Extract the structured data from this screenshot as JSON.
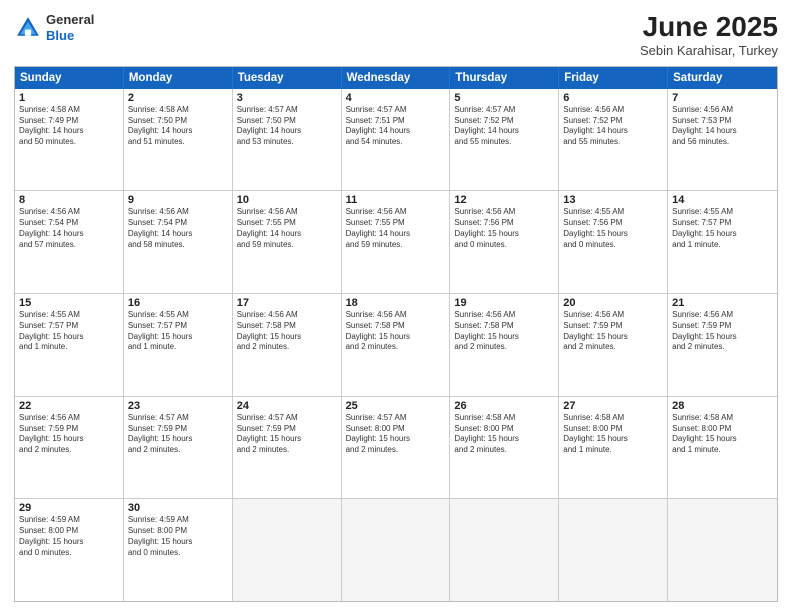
{
  "logo": {
    "general": "General",
    "blue": "Blue"
  },
  "title": "June 2025",
  "subtitle": "Sebin Karahisar, Turkey",
  "days": [
    "Sunday",
    "Monday",
    "Tuesday",
    "Wednesday",
    "Thursday",
    "Friday",
    "Saturday"
  ],
  "rows": [
    [
      {
        "day": "1",
        "lines": [
          "Sunrise: 4:58 AM",
          "Sunset: 7:49 PM",
          "Daylight: 14 hours",
          "and 50 minutes."
        ]
      },
      {
        "day": "2",
        "lines": [
          "Sunrise: 4:58 AM",
          "Sunset: 7:50 PM",
          "Daylight: 14 hours",
          "and 51 minutes."
        ]
      },
      {
        "day": "3",
        "lines": [
          "Sunrise: 4:57 AM",
          "Sunset: 7:50 PM",
          "Daylight: 14 hours",
          "and 53 minutes."
        ]
      },
      {
        "day": "4",
        "lines": [
          "Sunrise: 4:57 AM",
          "Sunset: 7:51 PM",
          "Daylight: 14 hours",
          "and 54 minutes."
        ]
      },
      {
        "day": "5",
        "lines": [
          "Sunrise: 4:57 AM",
          "Sunset: 7:52 PM",
          "Daylight: 14 hours",
          "and 55 minutes."
        ]
      },
      {
        "day": "6",
        "lines": [
          "Sunrise: 4:56 AM",
          "Sunset: 7:52 PM",
          "Daylight: 14 hours",
          "and 55 minutes."
        ]
      },
      {
        "day": "7",
        "lines": [
          "Sunrise: 4:56 AM",
          "Sunset: 7:53 PM",
          "Daylight: 14 hours",
          "and 56 minutes."
        ]
      }
    ],
    [
      {
        "day": "8",
        "lines": [
          "Sunrise: 4:56 AM",
          "Sunset: 7:54 PM",
          "Daylight: 14 hours",
          "and 57 minutes."
        ]
      },
      {
        "day": "9",
        "lines": [
          "Sunrise: 4:56 AM",
          "Sunset: 7:54 PM",
          "Daylight: 14 hours",
          "and 58 minutes."
        ]
      },
      {
        "day": "10",
        "lines": [
          "Sunrise: 4:56 AM",
          "Sunset: 7:55 PM",
          "Daylight: 14 hours",
          "and 59 minutes."
        ]
      },
      {
        "day": "11",
        "lines": [
          "Sunrise: 4:56 AM",
          "Sunset: 7:55 PM",
          "Daylight: 14 hours",
          "and 59 minutes."
        ]
      },
      {
        "day": "12",
        "lines": [
          "Sunrise: 4:56 AM",
          "Sunset: 7:56 PM",
          "Daylight: 15 hours",
          "and 0 minutes."
        ]
      },
      {
        "day": "13",
        "lines": [
          "Sunrise: 4:55 AM",
          "Sunset: 7:56 PM",
          "Daylight: 15 hours",
          "and 0 minutes."
        ]
      },
      {
        "day": "14",
        "lines": [
          "Sunrise: 4:55 AM",
          "Sunset: 7:57 PM",
          "Daylight: 15 hours",
          "and 1 minute."
        ]
      }
    ],
    [
      {
        "day": "15",
        "lines": [
          "Sunrise: 4:55 AM",
          "Sunset: 7:57 PM",
          "Daylight: 15 hours",
          "and 1 minute."
        ]
      },
      {
        "day": "16",
        "lines": [
          "Sunrise: 4:55 AM",
          "Sunset: 7:57 PM",
          "Daylight: 15 hours",
          "and 1 minute."
        ]
      },
      {
        "day": "17",
        "lines": [
          "Sunrise: 4:56 AM",
          "Sunset: 7:58 PM",
          "Daylight: 15 hours",
          "and 2 minutes."
        ]
      },
      {
        "day": "18",
        "lines": [
          "Sunrise: 4:56 AM",
          "Sunset: 7:58 PM",
          "Daylight: 15 hours",
          "and 2 minutes."
        ]
      },
      {
        "day": "19",
        "lines": [
          "Sunrise: 4:56 AM",
          "Sunset: 7:58 PM",
          "Daylight: 15 hours",
          "and 2 minutes."
        ]
      },
      {
        "day": "20",
        "lines": [
          "Sunrise: 4:56 AM",
          "Sunset: 7:59 PM",
          "Daylight: 15 hours",
          "and 2 minutes."
        ]
      },
      {
        "day": "21",
        "lines": [
          "Sunrise: 4:56 AM",
          "Sunset: 7:59 PM",
          "Daylight: 15 hours",
          "and 2 minutes."
        ]
      }
    ],
    [
      {
        "day": "22",
        "lines": [
          "Sunrise: 4:56 AM",
          "Sunset: 7:59 PM",
          "Daylight: 15 hours",
          "and 2 minutes."
        ]
      },
      {
        "day": "23",
        "lines": [
          "Sunrise: 4:57 AM",
          "Sunset: 7:59 PM",
          "Daylight: 15 hours",
          "and 2 minutes."
        ]
      },
      {
        "day": "24",
        "lines": [
          "Sunrise: 4:57 AM",
          "Sunset: 7:59 PM",
          "Daylight: 15 hours",
          "and 2 minutes."
        ]
      },
      {
        "day": "25",
        "lines": [
          "Sunrise: 4:57 AM",
          "Sunset: 8:00 PM",
          "Daylight: 15 hours",
          "and 2 minutes."
        ]
      },
      {
        "day": "26",
        "lines": [
          "Sunrise: 4:58 AM",
          "Sunset: 8:00 PM",
          "Daylight: 15 hours",
          "and 2 minutes."
        ]
      },
      {
        "day": "27",
        "lines": [
          "Sunrise: 4:58 AM",
          "Sunset: 8:00 PM",
          "Daylight: 15 hours",
          "and 1 minute."
        ]
      },
      {
        "day": "28",
        "lines": [
          "Sunrise: 4:58 AM",
          "Sunset: 8:00 PM",
          "Daylight: 15 hours",
          "and 1 minute."
        ]
      }
    ],
    [
      {
        "day": "29",
        "lines": [
          "Sunrise: 4:59 AM",
          "Sunset: 8:00 PM",
          "Daylight: 15 hours",
          "and 0 minutes."
        ]
      },
      {
        "day": "30",
        "lines": [
          "Sunrise: 4:59 AM",
          "Sunset: 8:00 PM",
          "Daylight: 15 hours",
          "and 0 minutes."
        ]
      },
      {
        "day": "",
        "lines": []
      },
      {
        "day": "",
        "lines": []
      },
      {
        "day": "",
        "lines": []
      },
      {
        "day": "",
        "lines": []
      },
      {
        "day": "",
        "lines": []
      }
    ]
  ]
}
